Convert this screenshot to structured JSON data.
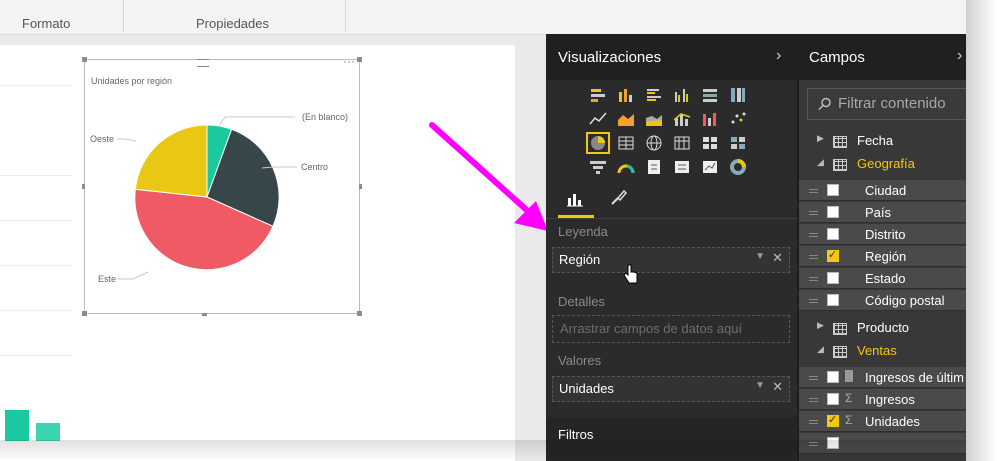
{
  "ribbon": {
    "group1": "Formato",
    "group2": "Propiedades"
  },
  "visual": {
    "title": "Unidades por región",
    "slices": [
      {
        "label": "(En blanco)",
        "color": "#1bc8a0"
      },
      {
        "label": "Centro",
        "color": "#374649"
      },
      {
        "label": "Este",
        "color": "#f05a64"
      },
      {
        "label": "Oeste",
        "color": "#e8c814"
      }
    ]
  },
  "viz_pane": {
    "title": "Visualizaciones",
    "chevron": "›",
    "tabs": [
      {
        "icon": "fields-tab-icon"
      },
      {
        "icon": "format-paintbrush-icon"
      }
    ],
    "sections": {
      "leyenda": "Leyenda",
      "detalles": "Detalles",
      "valores": "Valores",
      "filtros": "Filtros"
    },
    "wells": {
      "leyenda_value": "Región",
      "detalles_placeholder": "Arrastrar campos de datos aquí",
      "valores_value": "Unidades"
    }
  },
  "fields_pane": {
    "title": "Campos",
    "chevron": "›",
    "filter_placeholder": "Filtrar contenido",
    "tables": [
      {
        "name": "Fecha",
        "expanded": false
      },
      {
        "name": "Geografía",
        "expanded": true,
        "highlight": true,
        "fields": [
          {
            "name": "Ciudad",
            "checked": false
          },
          {
            "name": "País",
            "checked": false
          },
          {
            "name": "Distrito",
            "checked": false
          },
          {
            "name": "Región",
            "checked": true
          },
          {
            "name": "Estado",
            "checked": false
          },
          {
            "name": "Código postal",
            "checked": false
          }
        ]
      },
      {
        "name": "Producto",
        "expanded": false
      },
      {
        "name": "Ventas",
        "expanded": true,
        "highlight": true,
        "fields": [
          {
            "name": "Ingresos de últim",
            "checked": false,
            "icon": "calculator-icon"
          },
          {
            "name": "Ingresos",
            "checked": false,
            "icon": "sigma-icon"
          },
          {
            "name": "Unidades",
            "checked": true,
            "icon": "sigma-icon"
          }
        ]
      }
    ]
  },
  "colors": {
    "accent": "#f2c811",
    "arrow": "#ff00ff"
  }
}
